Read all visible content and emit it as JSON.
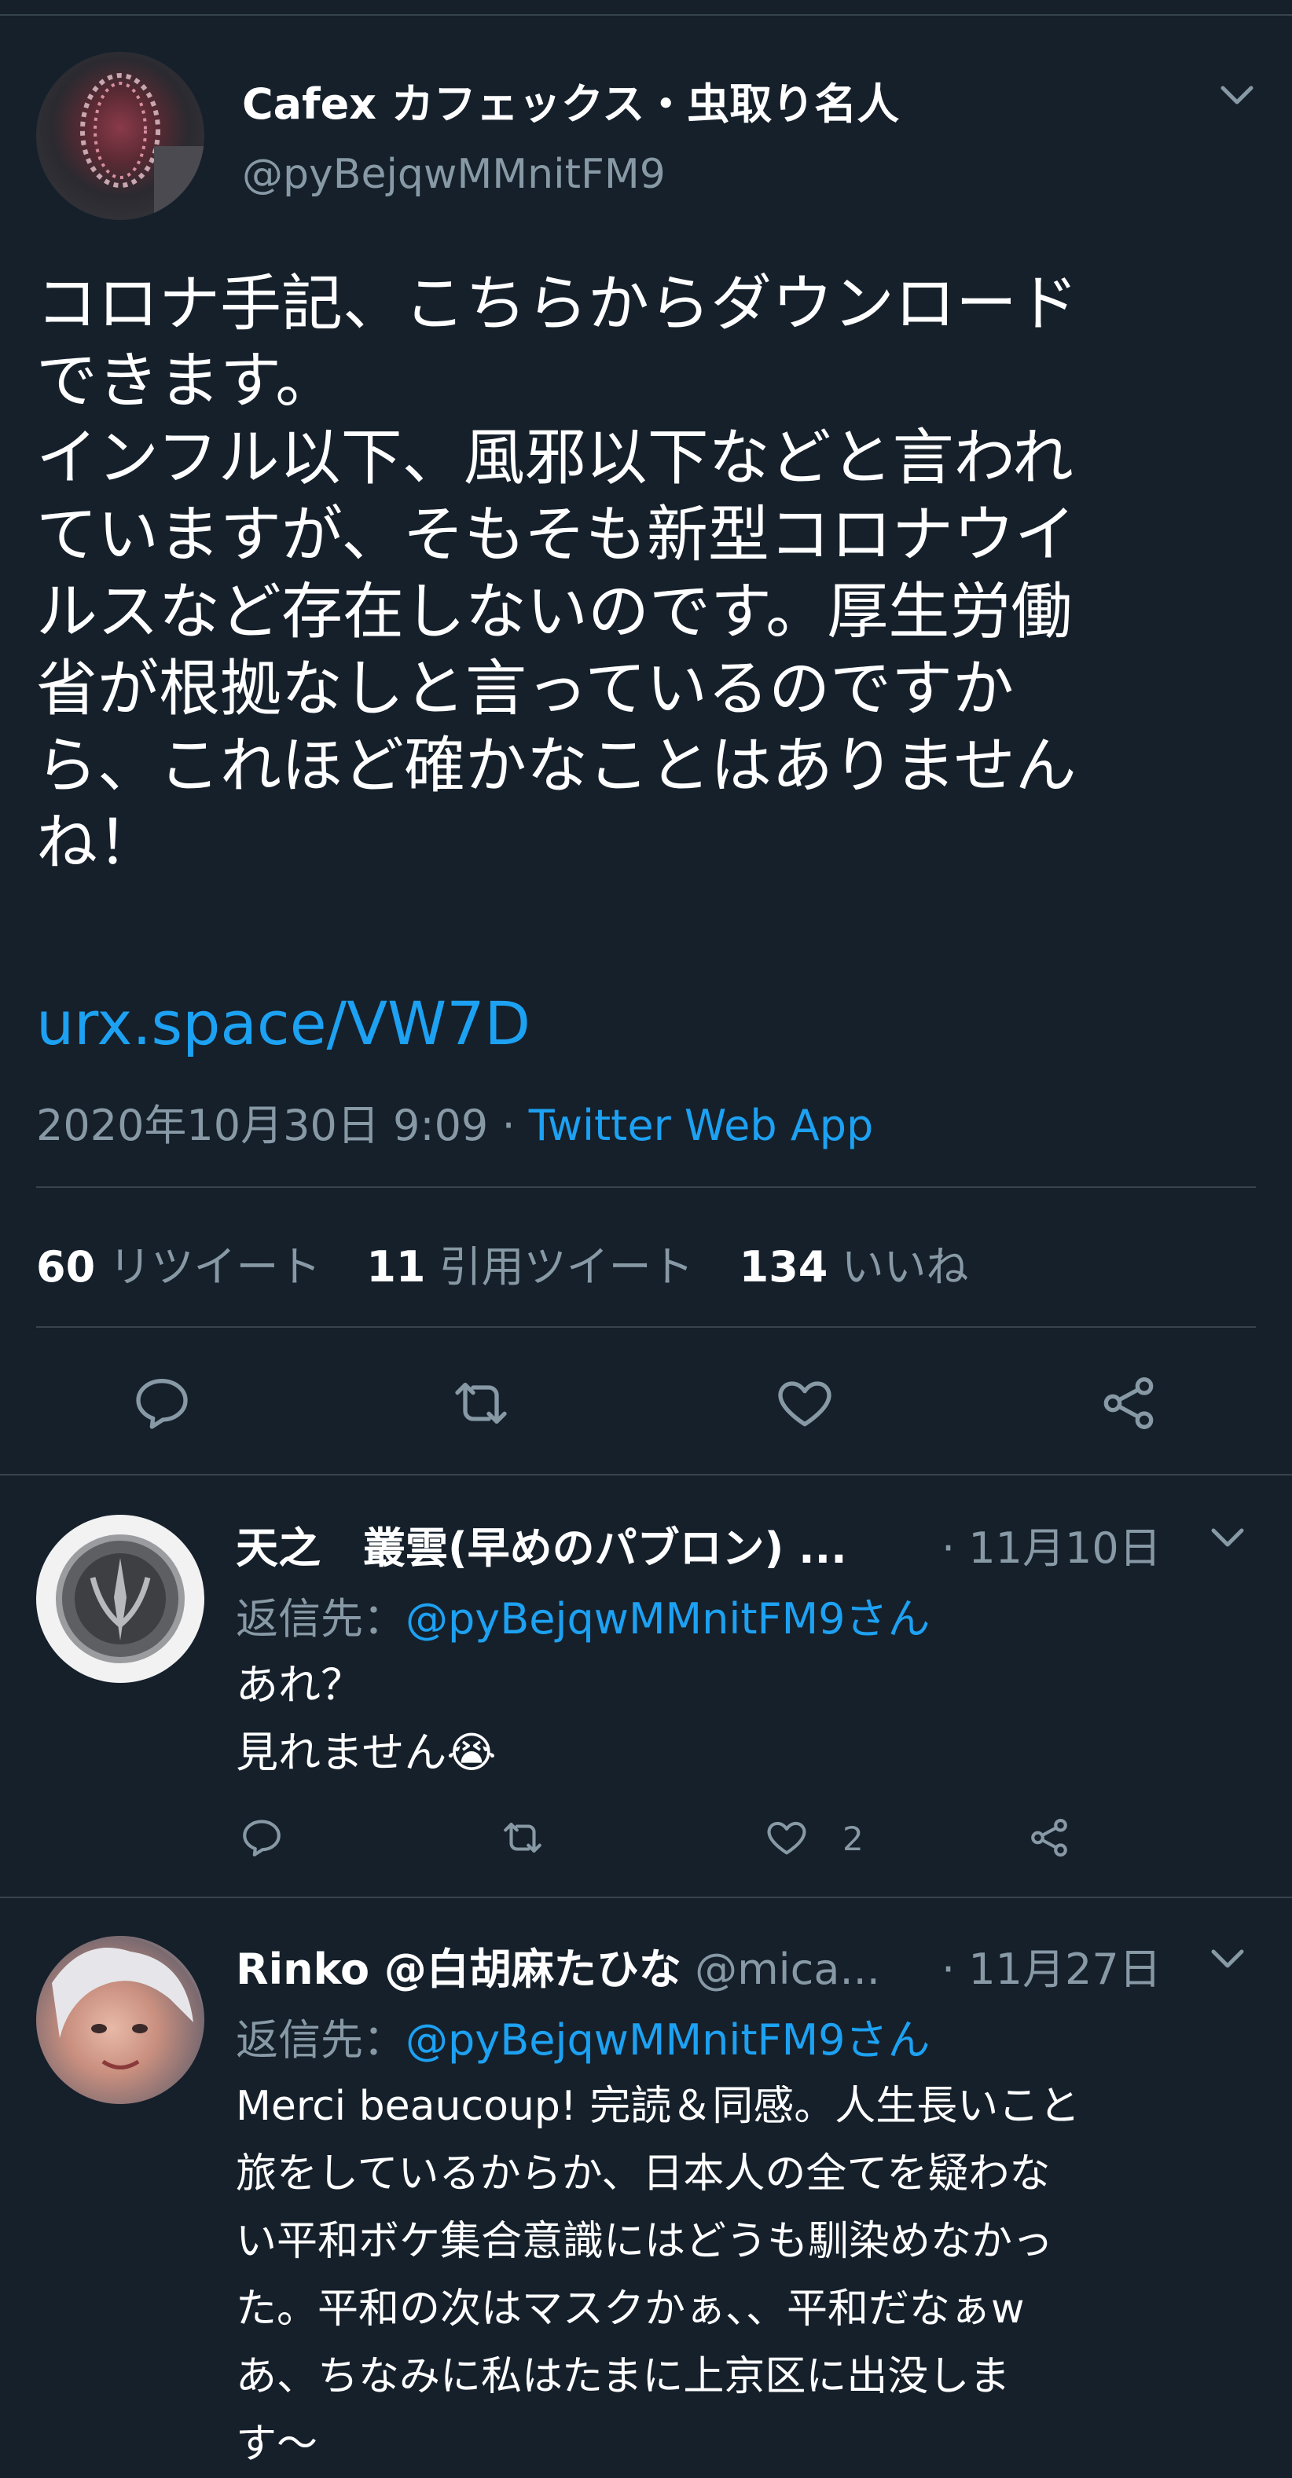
{
  "main_tweet": {
    "author_name": "Cafex カフェックス・虫取り名人",
    "handle": "@pyBejqwMMnitFM9",
    "text_lines": [
      "コロナ手記、こちらからダウンロード",
      "できます。",
      "インフル以下、風邪以下などと言われ",
      "ていますが、そもそも新型コロナウイ",
      "ルスなど存在しないのです。厚生労働",
      "省が根拠なしと言っているのですか",
      "ら、これほど確かなことはありません",
      "ね！"
    ],
    "link": "urx.space/VW7D",
    "timestamp": "2020年10月30日 9:09 · ",
    "source": "Twitter Web App",
    "stats": {
      "retweets_count": "60",
      "retweets_label": "リツイート",
      "quotes_count": "11",
      "quotes_label": "引用ツイート",
      "likes_count": "134",
      "likes_label": "いいね"
    }
  },
  "replies": [
    {
      "author_name": "天之　叢雲(早めのパブロン) ...",
      "date": "· 11月10日",
      "reply_to_prefix": "返信先：",
      "reply_to_handle": "@pyBejqwMMnitFM9さん",
      "text_lines": [
        "あれ？",
        "見れません😭"
      ],
      "likes": "2"
    },
    {
      "author_name": "Rinko @白胡麻たひな",
      "handle": "@mica...",
      "date": "· 11月27日",
      "reply_to_prefix": "返信先：",
      "reply_to_handle": "@pyBejqwMMnitFM9さん",
      "text_lines": [
        "Merci beaucoup! 完読＆同感。人生長いこと",
        "旅をしているからか、日本人の全てを疑わな",
        "い平和ボケ集合意識にはどうも馴染めなかっ",
        "た。平和の次はマスクかぁ、、平和だなぁw",
        "あ、ちなみに私はたまに上京区に出没しま",
        "す〜"
      ]
    }
  ],
  "icons": {
    "reply": "reply-icon",
    "retweet": "retweet-icon",
    "like": "heart-icon",
    "share": "share-icon",
    "more": "chevron-down-icon"
  },
  "colors": {
    "background": "#15202b",
    "link": "#1da1f2",
    "muted": "#8899a6",
    "divider": "#38444d"
  }
}
